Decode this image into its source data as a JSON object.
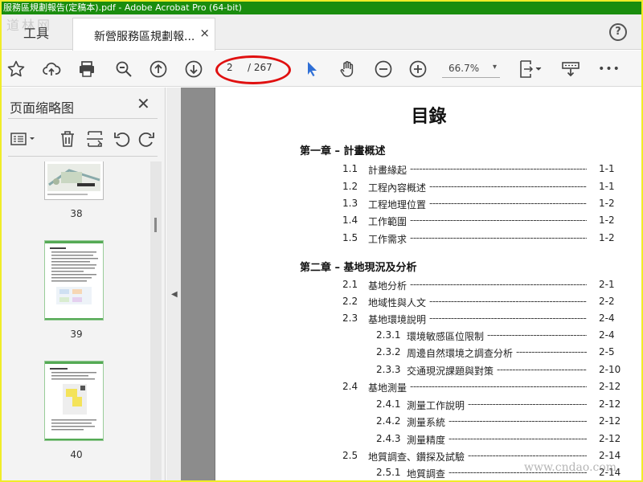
{
  "window": {
    "title": "服務區規劃報告(定稿本).pdf - Adobe Acrobat Pro (64-bit)"
  },
  "tabs": {
    "tools_label": "工具",
    "doc_label": "新營服務區規劃報...",
    "close_glyph": "×",
    "help_glyph": "?"
  },
  "toolbar": {
    "icons": [
      "star-icon",
      "cloud-upload-icon",
      "print-icon",
      "zoom-out-magnifier-icon",
      "page-up-icon",
      "page-down-icon",
      "select-arrow-icon",
      "hand-icon",
      "zoom-minus-icon",
      "zoom-plus-icon",
      "fit-page-icon",
      "scroll-mode-icon",
      "more-icon"
    ],
    "current_page": "2",
    "total_pages": "/ 267",
    "zoom": "66.7%",
    "zoom_caret": "▾",
    "more_glyph": "•••"
  },
  "sidebar": {
    "title": "页面缩略图",
    "close_glyph": "✕",
    "thumbnails": [
      {
        "page": "38"
      },
      {
        "page": "39"
      },
      {
        "page": "40"
      }
    ],
    "collapse_glyph": "◀"
  },
  "document": {
    "title": "目錄",
    "chapters": [
      {
        "label": "第一章 – 計畫概述"
      },
      {
        "label": "第二章 – 基地現況及分析"
      }
    ],
    "entries": [
      {
        "num": "1.1",
        "title": "計畫緣起",
        "page": "1-1",
        "level": 1
      },
      {
        "num": "1.2",
        "title": "工程內容概述",
        "page": "1-1",
        "level": 1
      },
      {
        "num": "1.3",
        "title": "工程地理位置",
        "page": "1-2",
        "level": 1
      },
      {
        "num": "1.4",
        "title": "工作範圍",
        "page": "1-2",
        "level": 1
      },
      {
        "num": "1.5",
        "title": "工作需求",
        "page": "1-2",
        "level": 1
      },
      {
        "num": "2.1",
        "title": "基地分析",
        "page": "2-1",
        "level": 1
      },
      {
        "num": "2.2",
        "title": "地域性與人文",
        "page": "2-2",
        "level": 1
      },
      {
        "num": "2.3",
        "title": "基地環境說明",
        "page": "2-4",
        "level": 1
      },
      {
        "num": "2.3.1",
        "title": "環境敏感區位限制",
        "page": "2-4",
        "level": 2
      },
      {
        "num": "2.3.2",
        "title": "周邊自然環境之調查分析",
        "page": "2-5",
        "level": 2
      },
      {
        "num": "2.3.3",
        "title": "交通現況課題與對策",
        "page": "2-10",
        "level": 2
      },
      {
        "num": "2.4",
        "title": "基地測量",
        "page": "2-12",
        "level": 1
      },
      {
        "num": "2.4.1",
        "title": "測量工作說明",
        "page": "2-12",
        "level": 2
      },
      {
        "num": "2.4.2",
        "title": "測量系統",
        "page": "2-12",
        "level": 2
      },
      {
        "num": "2.4.3",
        "title": "測量精度",
        "page": "2-12",
        "level": 2
      },
      {
        "num": "2.5",
        "title": "地質調查、鑽探及試驗",
        "page": "2-14",
        "level": 1
      },
      {
        "num": "2.5.1",
        "title": "地質調查",
        "page": "2-14",
        "level": 2
      }
    ]
  },
  "watermarks": {
    "top_left": "道林网",
    "bottom_right": "www.cndao.com"
  },
  "colors": {
    "title_bar": "#1a8d0e",
    "outer_border": "#f0ec28",
    "highlight_ellipse": "#e01010",
    "select_tool": "#2f6fd6"
  }
}
